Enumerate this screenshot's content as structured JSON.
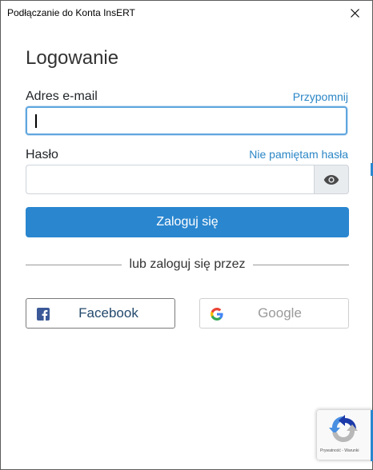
{
  "window": {
    "title": "Podłączanie do Konta InsERT"
  },
  "form": {
    "heading": "Logowanie",
    "email": {
      "label": "Adres e-mail",
      "link": "Przypomnij",
      "value": ""
    },
    "password": {
      "label": "Hasło",
      "link": "Nie pamiętam hasła",
      "value": ""
    },
    "login_button": "Zaloguj się",
    "divider_text": "lub zaloguj się przez"
  },
  "social": {
    "facebook_label": "Facebook",
    "google_label": "Google"
  },
  "recaptcha": {
    "text": "Prywatność - Warunki"
  },
  "colors": {
    "accent": "#2a86cf",
    "link": "#2a86c6",
    "facebook": "#3b5998"
  },
  "icons": [
    "close-icon",
    "eye-icon",
    "facebook-icon",
    "google-icon",
    "recaptcha-icon"
  ]
}
